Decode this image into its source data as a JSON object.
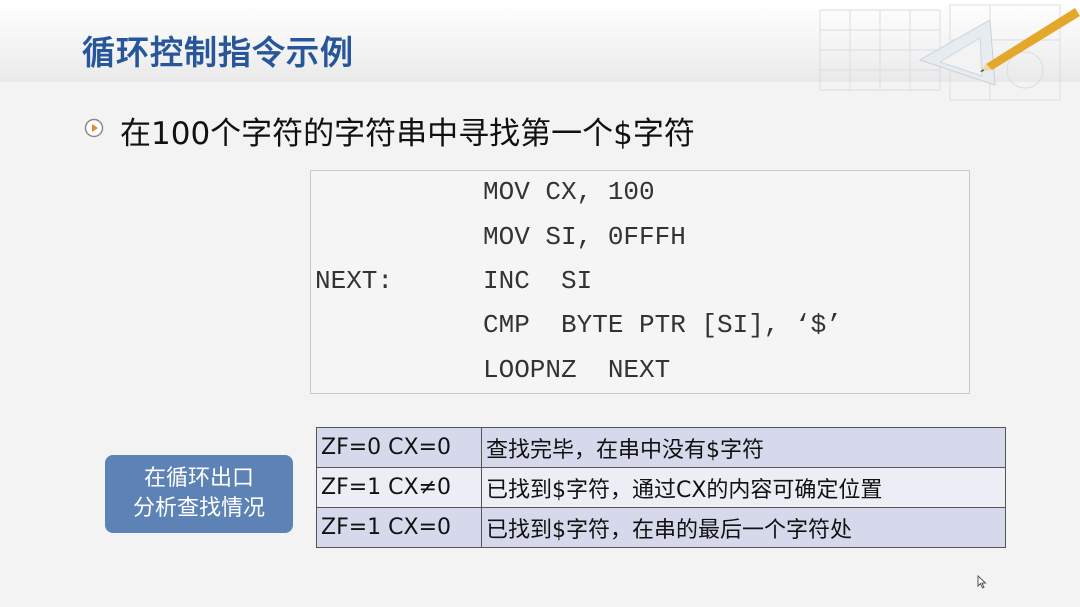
{
  "title": "循环控制指令示例",
  "bullet": {
    "icon": "play-circle-icon",
    "text": "在100个字符的字符串中寻找第一个$字符"
  },
  "code": [
    {
      "label": "",
      "instr": "MOV CX, 100"
    },
    {
      "label": "",
      "instr": "MOV SI, 0FFFH"
    },
    {
      "label": "NEXT:",
      "instr": "INC  SI"
    },
    {
      "label": "",
      "instr": "CMP  BYTE PTR [SI], ‘$’"
    },
    {
      "label": "",
      "instr": "LOOPNZ  NEXT"
    }
  ],
  "badge": {
    "line1": "在循环出口",
    "line2": "分析查找情况"
  },
  "table": [
    {
      "cond": "ZF=0  CX=0",
      "desc": "查找完毕，在串中没有$字符"
    },
    {
      "cond": "ZF=1  CX≠0",
      "desc": "已找到$字符，通过CX的内容可确定位置"
    },
    {
      "cond": "ZF=1  CX=0",
      "desc": "已找到$字符，在串的最后一个字符处"
    }
  ],
  "colors": {
    "title": "#27579a",
    "badge": "#5d82b5",
    "row_dark": "#d6d9ec",
    "row_light": "#eceef6"
  }
}
